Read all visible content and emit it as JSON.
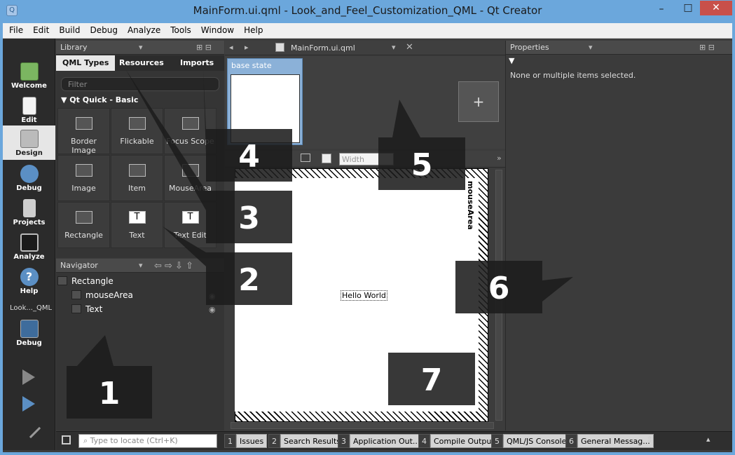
{
  "window": {
    "title": "MainForm.ui.qml - Look_and_Feel_Customization_QML - Qt Creator",
    "minimize": "–",
    "maximize": "□",
    "close": "✕",
    "app_icon_glyph": "Q"
  },
  "menu": [
    "File",
    "Edit",
    "Build",
    "Debug",
    "Analyze",
    "Tools",
    "Window",
    "Help"
  ],
  "modes": [
    {
      "label": "Welcome",
      "icon": "qt-logo-icon"
    },
    {
      "label": "Edit",
      "icon": "document-icon"
    },
    {
      "label": "Design",
      "icon": "design-pencil-icon",
      "active": true
    },
    {
      "label": "Debug",
      "icon": "debug-bug-icon"
    },
    {
      "label": "Projects",
      "icon": "projects-icon"
    },
    {
      "label": "Analyze",
      "icon": "analyze-monitor-icon"
    },
    {
      "label": "Help",
      "icon": "help-icon"
    }
  ],
  "kit": {
    "label": "Look..._QML",
    "target": "Debug"
  },
  "library": {
    "header": "Library",
    "tabs": [
      "QML Types",
      "Resources",
      "Imports"
    ],
    "filter_placeholder": "Filter",
    "section": "Qt Quick - Basic",
    "items": [
      "Border Image",
      "Flickable",
      "Focus Scope",
      "Image",
      "Item",
      "MouseArea",
      "Rectangle",
      "Text",
      "Text Edit"
    ]
  },
  "navigator": {
    "header": "Navigator",
    "tree": [
      "Rectangle",
      "mouseArea",
      "Text"
    ]
  },
  "editor": {
    "filename": "MainForm.ui.qml",
    "state_label": "base state",
    "add_state": "+",
    "width_placeholder": "Width",
    "canvas_text": "Hello World",
    "mouse_area_label": "mouseArea"
  },
  "properties": {
    "header": "Properties",
    "message": "None or multiple items selected."
  },
  "status": {
    "locate_placeholder": "Type to locate (Ctrl+K)",
    "tabs": [
      {
        "num": "1",
        "label": "Issues"
      },
      {
        "num": "2",
        "label": "Search Results"
      },
      {
        "num": "3",
        "label": "Application Out..."
      },
      {
        "num": "4",
        "label": "Compile Output"
      },
      {
        "num": "5",
        "label": "QML/JS Console"
      },
      {
        "num": "6",
        "label": "General Messag..."
      }
    ]
  },
  "callouts": [
    "1",
    "2",
    "3",
    "4",
    "5",
    "6",
    "7"
  ],
  "colors": {
    "title_bar": "#6ba7dc",
    "dark_panel": "#353535",
    "callout": "#1c1c1c"
  }
}
